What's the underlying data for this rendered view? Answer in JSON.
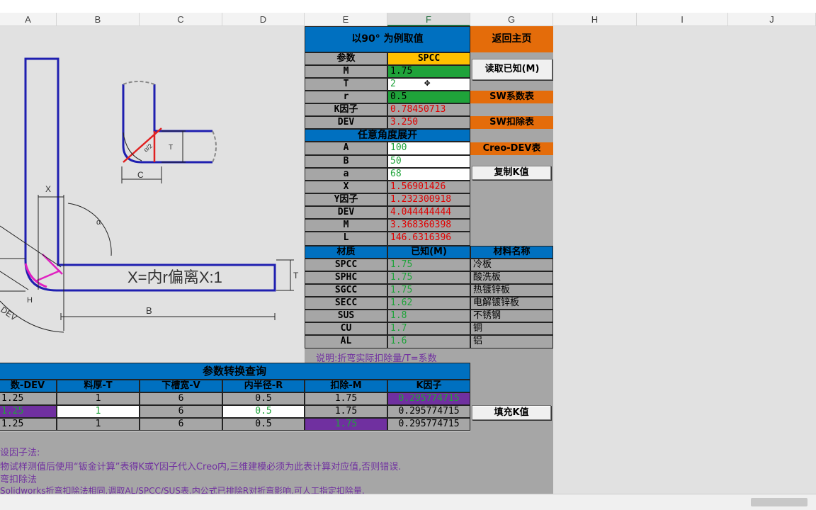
{
  "columns": [
    "A",
    "B",
    "C",
    "D",
    "E",
    "F",
    "G",
    "H",
    "I",
    "J"
  ],
  "selected_column": "F",
  "drawing": {
    "formula": "X=内r偏离X:1",
    "labels": [
      "X",
      "T",
      "H",
      "DEV",
      "B",
      "C",
      "T",
      "α",
      "α/2"
    ]
  },
  "top": {
    "title": "以90° 为例取值",
    "home_button": "返回主页"
  },
  "params": {
    "header_label": "参数",
    "header_value": "SPCC",
    "rows": [
      {
        "label": "M",
        "value": "1.75"
      },
      {
        "label": "T",
        "value": "2"
      },
      {
        "label": "r",
        "value": "0.5"
      },
      {
        "label": "K因子",
        "value": "0.78450713"
      },
      {
        "label": "DEV",
        "value": "3.250"
      }
    ]
  },
  "arbitrary": {
    "title": "任意角度展开",
    "rows": [
      {
        "label": "A",
        "value": "100"
      },
      {
        "label": "B",
        "value": "50"
      },
      {
        "label": "a",
        "value": "68"
      },
      {
        "label": "X",
        "value": "1.56901426"
      },
      {
        "label": "Y因子",
        "value": "1.232300918"
      },
      {
        "label": "DEV",
        "value": "4.044444444"
      },
      {
        "label": "M",
        "value": "3.368360398"
      },
      {
        "label": "L",
        "value": "146.6316396"
      }
    ]
  },
  "buttons": {
    "read": "读取已知(M)",
    "sw_coef": "SW系数表",
    "sw_deduct": "SW扣除表",
    "creo": "Creo-DEV表",
    "copy_k": "复制K值",
    "fill_k": "填充K值"
  },
  "materials": {
    "headers": [
      "材质",
      "已知(M)",
      "材料名称"
    ],
    "rows": [
      {
        "code": "SPCC",
        "m": "1.75",
        "name": "冷板"
      },
      {
        "code": "SPHC",
        "m": "1.75",
        "name": "酸洗板"
      },
      {
        "code": "SGCC",
        "m": "1.75",
        "name": "热镀锌板"
      },
      {
        "code": "SECC",
        "m": "1.62",
        "name": "电解镀锌板"
      },
      {
        "code": "SUS",
        "m": "1.8",
        "name": "不锈钢"
      },
      {
        "code": "CU",
        "m": "1.7",
        "name": "铜"
      },
      {
        "code": "AL",
        "m": "1.6",
        "name": "铝"
      }
    ],
    "note": "说明:折弯实际扣除量/T=系数"
  },
  "conversion": {
    "title": "参数转换查询",
    "headers": [
      "数-DEV",
      "料厚-T",
      "下槽宽-V",
      "内半径-R",
      "扣除-M",
      "K因子"
    ],
    "rows": [
      [
        "1.25",
        "1",
        "6",
        "0.5",
        "1.75",
        "0.295774715"
      ],
      [
        "1.25",
        "1",
        "6",
        "0.5",
        "1.75",
        "0.295774715"
      ],
      [
        "1.25",
        "1",
        "6",
        "0.5",
        "1.75",
        "0.295774715"
      ]
    ]
  },
  "notes": [
    "设因子法:",
    "物试样测值后使用“钣金计算”表得K或Y因子代入Creo内,三维建模必须为此表计算对应值,否则错误.",
    "弯扣除法",
    "Solidworks折弯扣除法相同,调取AL/SPCC/SUS表,内公式已排除R对折弯影响,可人工指定扣除量."
  ],
  "colors": {
    "blue": "#0070c0",
    "orange": "#e46c0a",
    "gold": "#ffc000",
    "green": "#1fa33a",
    "red": "#e00000",
    "purple": "#7030a0"
  }
}
